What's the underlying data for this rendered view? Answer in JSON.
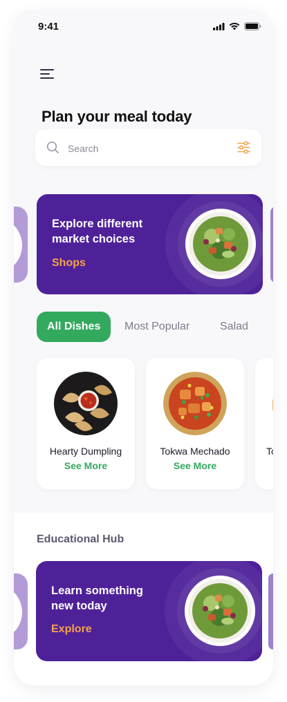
{
  "status_bar": {
    "time": "9:41"
  },
  "header": {
    "title": "Plan your meal today"
  },
  "search": {
    "placeholder": "Search"
  },
  "promo": {
    "line1": "Explore different",
    "line2": "market choices",
    "cta": "Shops"
  },
  "tabs": [
    {
      "label": "All Dishes",
      "active": true
    },
    {
      "label": "Most Popular",
      "active": false
    },
    {
      "label": "Salad",
      "active": false
    }
  ],
  "dishes": [
    {
      "name": "Hearty Dumpling",
      "action": "See More"
    },
    {
      "name": "Tokwa Mechado",
      "action": "See More"
    },
    {
      "name": "To",
      "action": ""
    }
  ],
  "education": {
    "section_title": "Educational Hub",
    "line1": "Learn something",
    "line2": "new today",
    "cta": "Explore"
  },
  "colors": {
    "primary_purple": "#4f2199",
    "accent_orange": "#f2a34a",
    "accent_green": "#33a95e",
    "background": "#f8f8fa"
  },
  "icons": [
    "menu-icon",
    "search-icon",
    "filter-icon",
    "signal-icon",
    "wifi-icon",
    "battery-icon"
  ]
}
